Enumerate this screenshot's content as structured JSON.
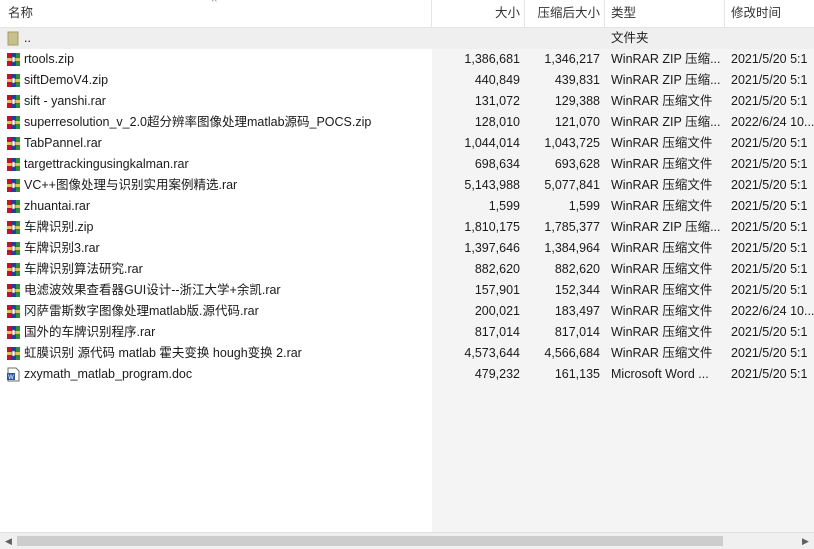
{
  "columns": {
    "name": "名称",
    "size": "大小",
    "packed": "压缩后大小",
    "type": "类型",
    "modified": "修改时间",
    "sort_indicator": "^"
  },
  "colors": {
    "rar_icon_red": "#c8102e",
    "rar_icon_blue": "#1f3fa8",
    "rar_icon_green": "#2e8b3e",
    "folder_icon": "#c7c08a",
    "doc_icon": "#2b579a"
  },
  "rows": [
    {
      "icon": "folder-up-icon",
      "name": "..",
      "size": "",
      "packed": "",
      "type": "文件夹",
      "modified": ""
    },
    {
      "icon": "archive-icon",
      "name": "rtools.zip",
      "size": "1,386,681",
      "packed": "1,346,217",
      "type": "WinRAR ZIP 压缩...",
      "modified": "2021/5/20 5:1"
    },
    {
      "icon": "archive-icon",
      "name": "siftDemoV4.zip",
      "size": "440,849",
      "packed": "439,831",
      "type": "WinRAR ZIP 压缩...",
      "modified": "2021/5/20 5:1"
    },
    {
      "icon": "archive-icon",
      "name": "sift - yanshi.rar",
      "size": "131,072",
      "packed": "129,388",
      "type": "WinRAR 压缩文件",
      "modified": "2021/5/20 5:1"
    },
    {
      "icon": "archive-icon",
      "name": "superresolution_v_2.0超分辨率图像处理matlab源码_POCS.zip",
      "size": "128,010",
      "packed": "121,070",
      "type": "WinRAR ZIP 压缩...",
      "modified": "2022/6/24 10..."
    },
    {
      "icon": "archive-icon",
      "name": "TabPannel.rar",
      "size": "1,044,014",
      "packed": "1,043,725",
      "type": "WinRAR 压缩文件",
      "modified": "2021/5/20 5:1"
    },
    {
      "icon": "archive-icon",
      "name": "targettrackingusingkalman.rar",
      "size": "698,634",
      "packed": "693,628",
      "type": "WinRAR 压缩文件",
      "modified": "2021/5/20 5:1"
    },
    {
      "icon": "archive-icon",
      "name": "VC++图像处理与识别实用案例精选.rar",
      "size": "5,143,988",
      "packed": "5,077,841",
      "type": "WinRAR 压缩文件",
      "modified": "2021/5/20 5:1"
    },
    {
      "icon": "archive-icon",
      "name": "zhuantai.rar",
      "size": "1,599",
      "packed": "1,599",
      "type": "WinRAR 压缩文件",
      "modified": "2021/5/20 5:1"
    },
    {
      "icon": "archive-icon",
      "name": "车牌识别.zip",
      "size": "1,810,175",
      "packed": "1,785,377",
      "type": "WinRAR ZIP 压缩...",
      "modified": "2021/5/20 5:1"
    },
    {
      "icon": "archive-icon",
      "name": "车牌识别3.rar",
      "size": "1,397,646",
      "packed": "1,384,964",
      "type": "WinRAR 压缩文件",
      "modified": "2021/5/20 5:1"
    },
    {
      "icon": "archive-icon",
      "name": "车牌识别算法研究.rar",
      "size": "882,620",
      "packed": "882,620",
      "type": "WinRAR 压缩文件",
      "modified": "2021/5/20 5:1"
    },
    {
      "icon": "archive-icon",
      "name": "电滤波效果查看器GUI设计--浙江大学+余凯.rar",
      "size": "157,901",
      "packed": "152,344",
      "type": "WinRAR 压缩文件",
      "modified": "2021/5/20 5:1"
    },
    {
      "icon": "archive-icon",
      "name": "冈萨雷斯数字图像处理matlab版.源代码.rar",
      "size": "200,021",
      "packed": "183,497",
      "type": "WinRAR 压缩文件",
      "modified": "2022/6/24 10..."
    },
    {
      "icon": "archive-icon",
      "name": "国外的车牌识别程序.rar",
      "size": "817,014",
      "packed": "817,014",
      "type": "WinRAR 压缩文件",
      "modified": "2021/5/20 5:1"
    },
    {
      "icon": "archive-icon",
      "name": "虹膜识别 源代码 matlab 霍夫变换 hough变换 2.rar",
      "size": "4,573,644",
      "packed": "4,566,684",
      "type": "WinRAR 压缩文件",
      "modified": "2021/5/20 5:1"
    },
    {
      "icon": "word-doc-icon",
      "name": "zxymath_matlab_program.doc",
      "size": "479,232",
      "packed": "161,135",
      "type": "Microsoft Word ...",
      "modified": "2021/5/20 5:1"
    }
  ],
  "scrollbar": {
    "left_arrow": "◀",
    "right_arrow": "▶"
  }
}
